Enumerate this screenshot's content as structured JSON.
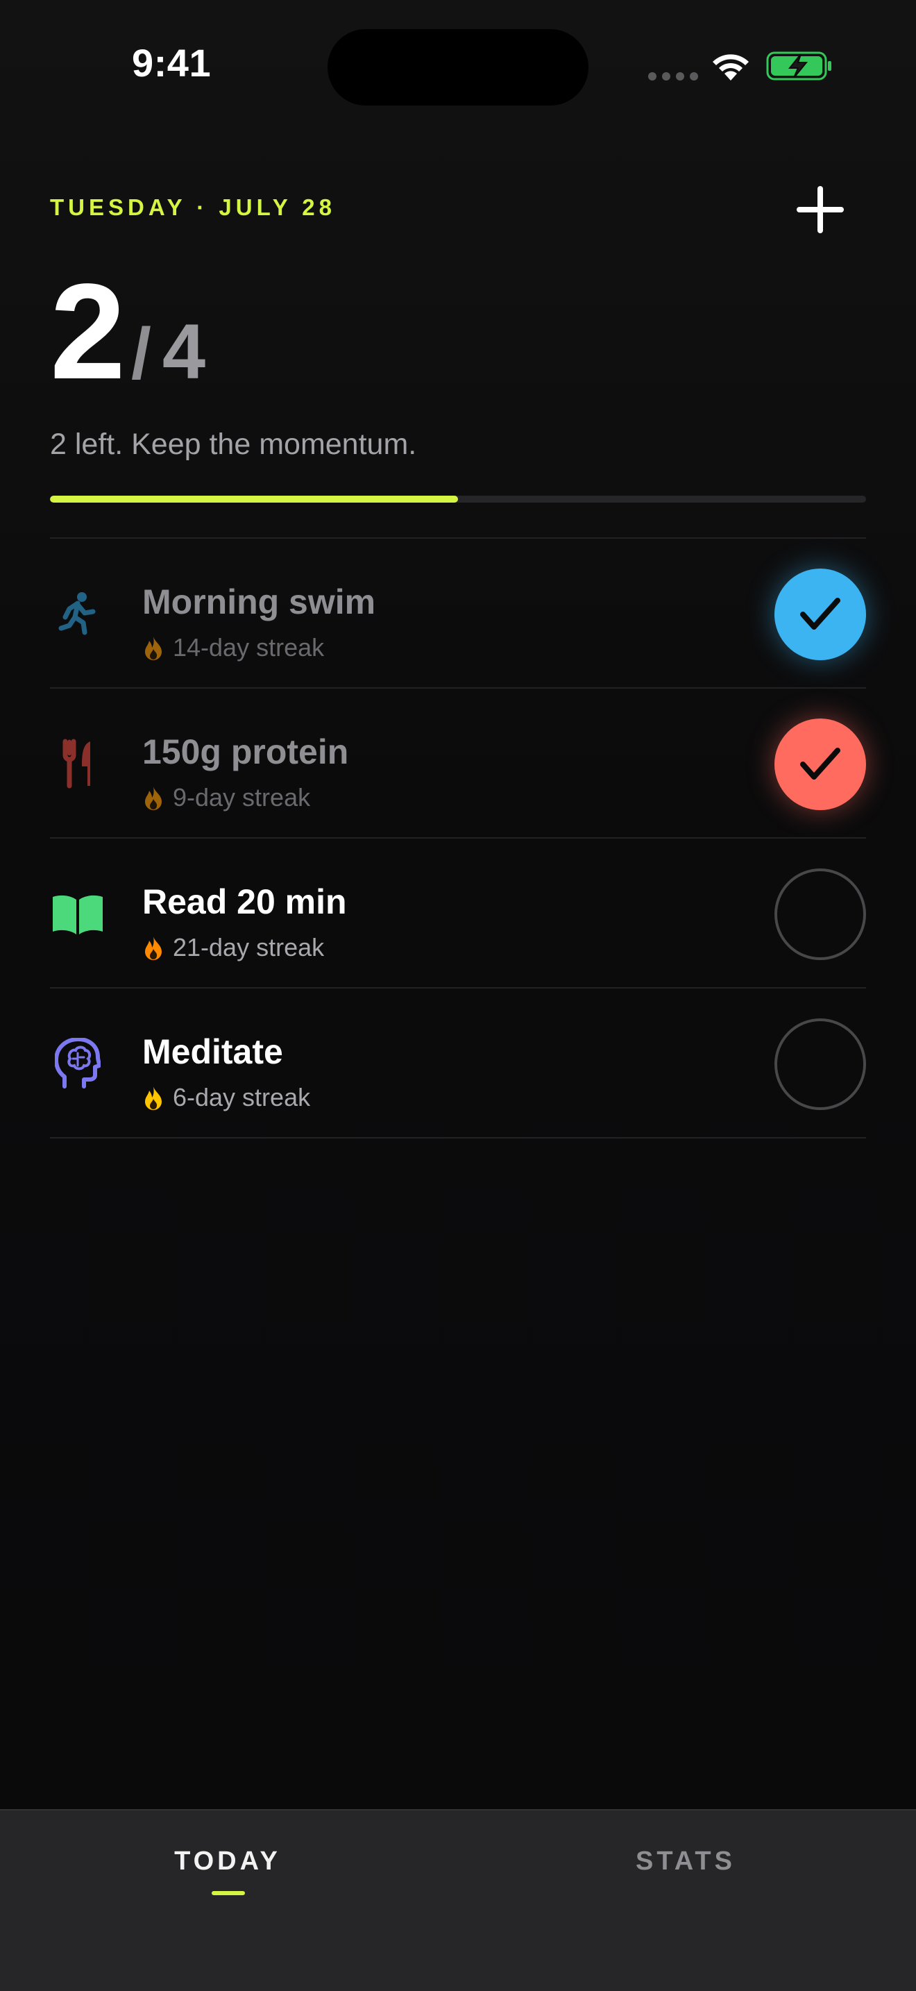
{
  "status_bar": {
    "time": "9:41",
    "battery_color": "#34c759"
  },
  "header": {
    "date": "TUESDAY · JULY 28",
    "add_icon": "plus-icon"
  },
  "progress": {
    "done": "2",
    "separator": "/",
    "total": "4",
    "message": "2 left. Keep the momentum.",
    "fraction": 0.5,
    "accent": "#d4f542"
  },
  "habits": [
    {
      "name": "Morning swim",
      "streak": "14-day streak",
      "icon": "running-person-icon",
      "color": "#2f9bd6",
      "completed": true,
      "check_color": "#3db4f2"
    },
    {
      "name": "150g protein",
      "streak": "9-day streak",
      "icon": "fork-knife-icon",
      "color": "#e0483e",
      "completed": true,
      "check_color": "#ff6b5e"
    },
    {
      "name": "Read 20 min",
      "streak": "21-day streak",
      "icon": "open-book-icon",
      "color": "#4cd97b",
      "completed": false
    },
    {
      "name": "Meditate",
      "streak": "6-day streak",
      "icon": "brain-head-icon",
      "color": "#7b78f0",
      "completed": false
    }
  ],
  "tabs": [
    {
      "label": "TODAY",
      "active": true
    },
    {
      "label": "STATS",
      "active": false
    }
  ]
}
